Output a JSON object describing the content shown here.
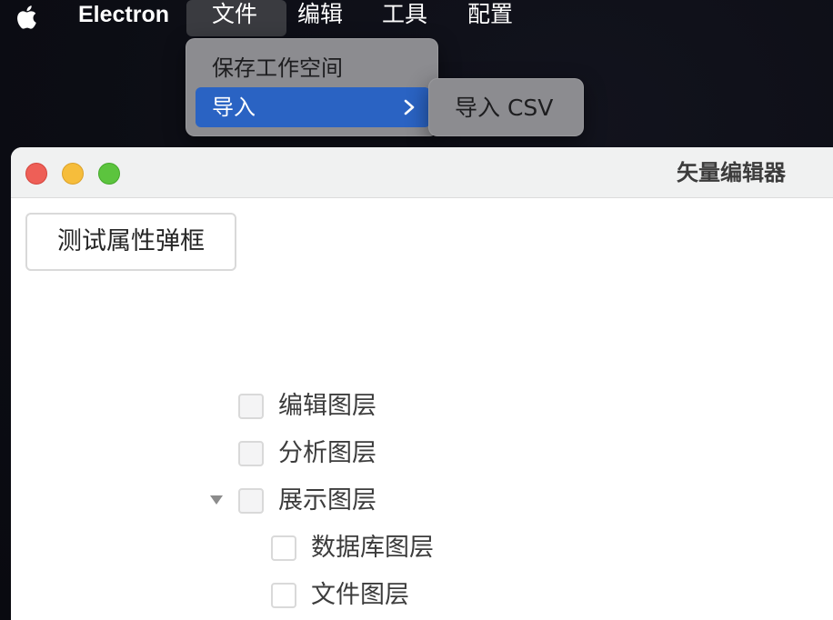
{
  "menubar": {
    "app_name": "Electron",
    "items": [
      {
        "label": "文件",
        "active": true
      },
      {
        "label": "编辑"
      },
      {
        "label": "工具"
      },
      {
        "label": "配置"
      }
    ]
  },
  "file_menu": {
    "items": [
      {
        "label": "保存工作空间"
      },
      {
        "label": "导入",
        "has_submenu": true,
        "highlighted": true
      }
    ],
    "submenu": {
      "items": [
        {
          "label": "导入 CSV"
        }
      ]
    }
  },
  "window": {
    "title": "矢量编辑器",
    "test_button_label": "测试属性弹框",
    "layer_tree": [
      {
        "label": "编辑图层",
        "checked": false
      },
      {
        "label": "分析图层",
        "checked": false
      },
      {
        "label": "展示图层",
        "checked": false,
        "expanded": true,
        "children": [
          {
            "label": "数据库图层",
            "checked": false
          },
          {
            "label": "文件图层",
            "checked": false
          }
        ]
      }
    ]
  },
  "colors": {
    "menu_highlight": "#2a63c3",
    "close": "#ee5f57",
    "minimize": "#f6bd3b",
    "maximize": "#5cc43e"
  },
  "icons": [
    "apple-logo-icon",
    "chevron-right-icon",
    "caret-down-icon"
  ]
}
